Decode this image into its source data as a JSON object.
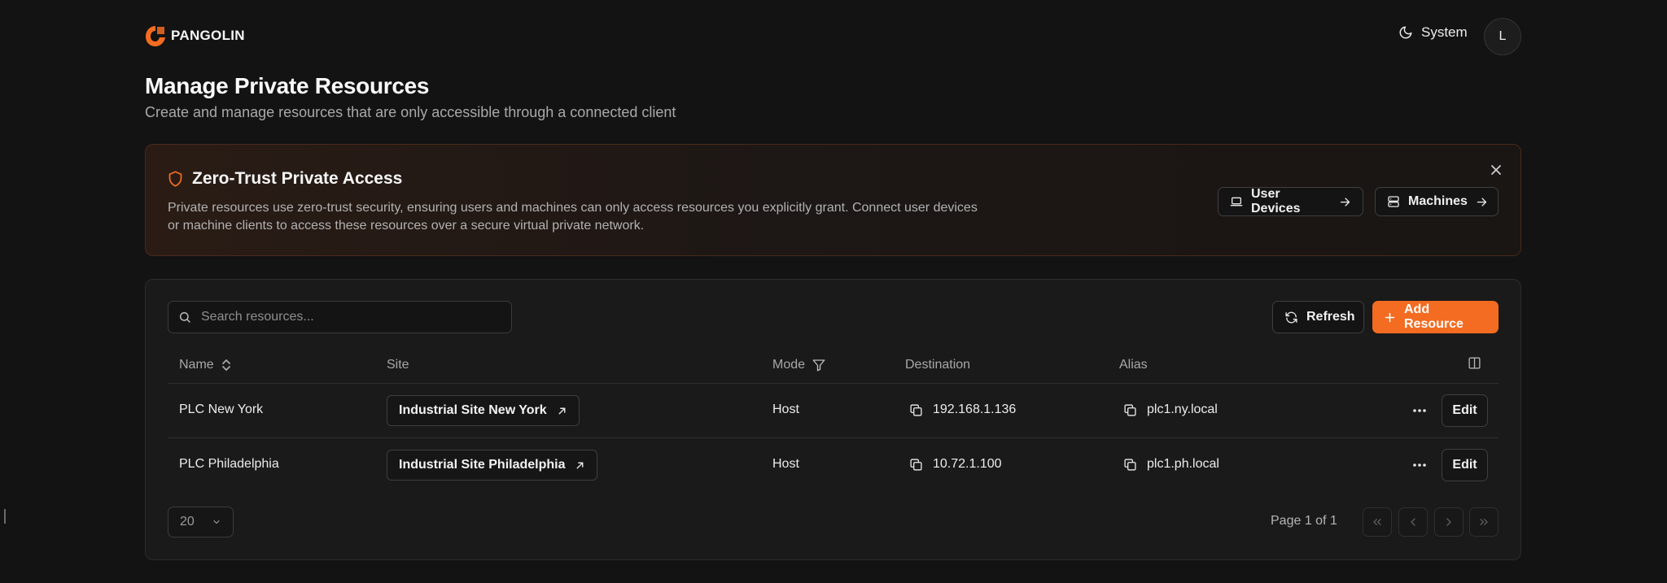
{
  "brand": {
    "name": "PANGOLIN",
    "color": "#f36c21"
  },
  "header": {
    "theme_label": "System",
    "avatar_initial": "L"
  },
  "page": {
    "title": "Manage Private Resources",
    "subtitle": "Create and manage resources that are only accessible through a connected client"
  },
  "banner": {
    "title": "Zero-Trust Private Access",
    "description": "Private resources use zero-trust security, ensuring users and machines can only access resources you explicitly grant. Connect user devices or machine clients to access these resources over a secure virtual private network.",
    "user_devices_label": "User Devices",
    "machines_label": "Machines"
  },
  "toolbar": {
    "search_placeholder": "Search resources...",
    "refresh_label": "Refresh",
    "add_label": "Add Resource"
  },
  "table": {
    "columns": {
      "name": "Name",
      "site": "Site",
      "mode": "Mode",
      "destination": "Destination",
      "alias": "Alias"
    },
    "rows": [
      {
        "name": "PLC New York",
        "site": "Industrial Site New York",
        "mode": "Host",
        "destination": "192.168.1.136",
        "alias": "plc1.ny.local",
        "edit": "Edit"
      },
      {
        "name": "PLC Philadelphia",
        "site": "Industrial Site Philadelphia",
        "mode": "Host",
        "destination": "10.72.1.100",
        "alias": "plc1.ph.local",
        "edit": "Edit"
      }
    ]
  },
  "pagination": {
    "page_size": "20",
    "page_info": "Page 1 of 1"
  },
  "icons": {
    "logo": "pangolin-logo-icon",
    "theme": "moon-icon",
    "banner": "shield-icon",
    "close": "close-icon",
    "laptop": "laptop-icon",
    "server": "server-icon",
    "arrow": "arrow-right-icon",
    "search": "search-icon",
    "refresh": "refresh-icon",
    "plus": "plus-icon",
    "sort": "sort-icon",
    "filter": "filter-icon",
    "columns": "columns-icon",
    "external": "external-link-icon",
    "copy": "copy-icon",
    "more": "more-icon"
  }
}
